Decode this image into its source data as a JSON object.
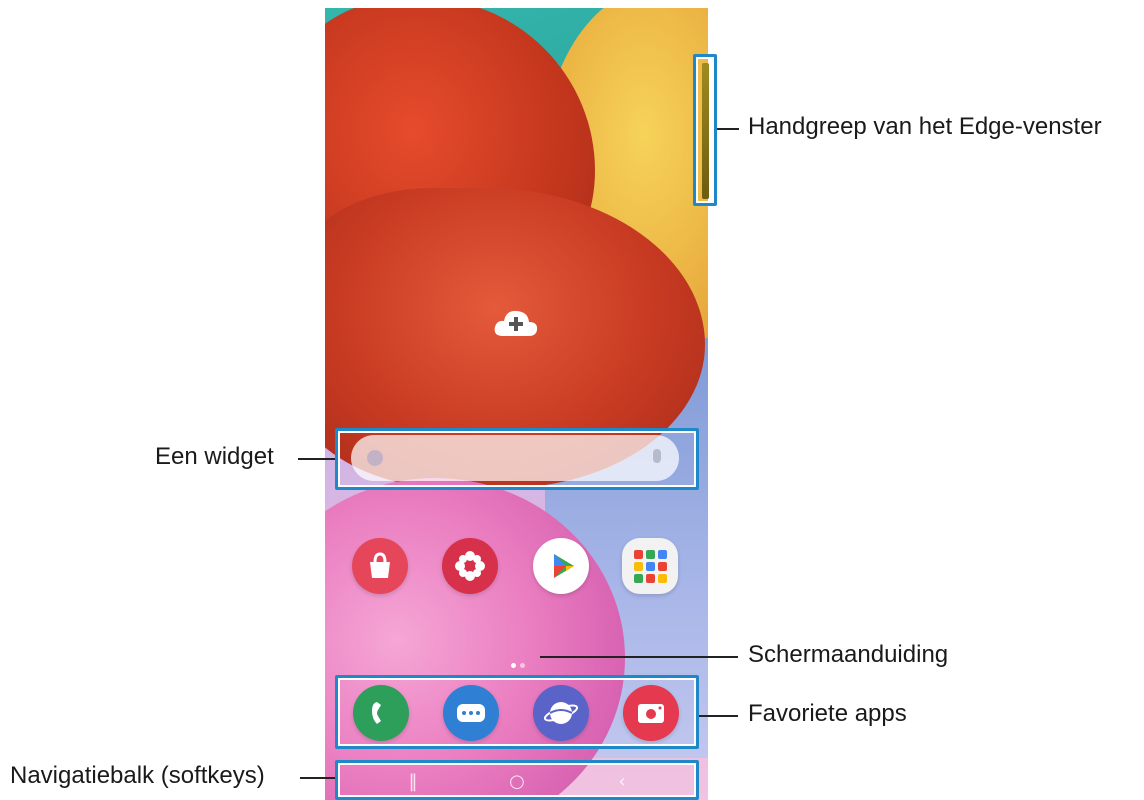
{
  "labels": {
    "edge_handle": "Handgreep van het Edge-venster",
    "widget": "Een widget",
    "screen_indicator": "Schermaanduiding",
    "favorite_apps": "Favoriete apps",
    "navigation_bar": "Navigatiebalk (softkeys)"
  },
  "home_screen": {
    "apps": [
      {
        "name": "Galaxy Store",
        "icon": "shopping-bag-icon",
        "color": "#e5465a"
      },
      {
        "name": "Galaxy Apps",
        "icon": "flower-icon",
        "color": "#d6304a"
      },
      {
        "name": "Play Store",
        "icon": "play-store-icon",
        "color": "#ffffff"
      },
      {
        "name": "Google folder",
        "icon": "app-folder-icon",
        "color": "#f2f2f2"
      }
    ],
    "favorites": [
      {
        "name": "Phone",
        "icon": "phone-icon",
        "color": "#2e9e5b"
      },
      {
        "name": "Messages",
        "icon": "messages-icon",
        "color": "#2f7fd4"
      },
      {
        "name": "Internet",
        "icon": "internet-icon",
        "color": "#5a63c8"
      },
      {
        "name": "Camera",
        "icon": "camera-icon",
        "color": "#e4394e"
      }
    ],
    "page_count": 2,
    "active_page": 1
  },
  "colors": {
    "highlight": "#1f88c8",
    "callout": "#222222"
  }
}
